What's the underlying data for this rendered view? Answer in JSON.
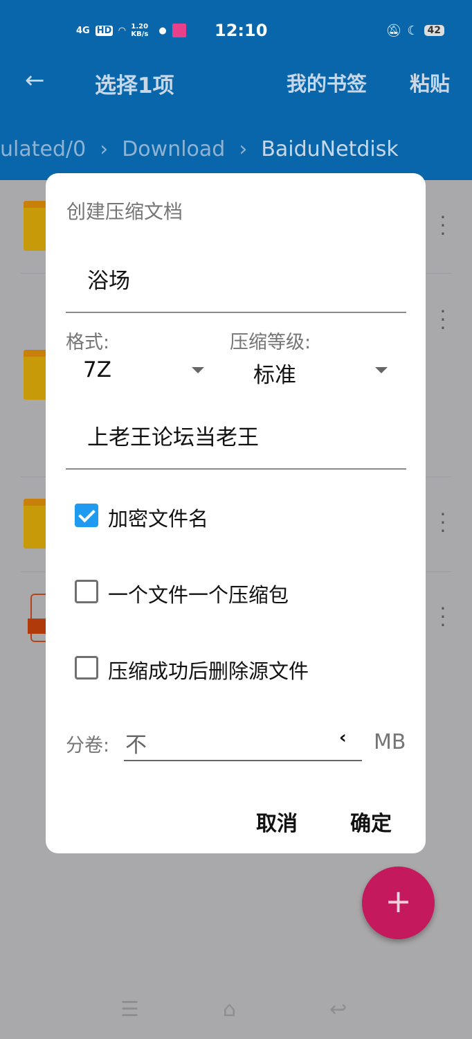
{
  "status": {
    "network": "4G",
    "hd": "HD",
    "speed": "1.20 KB/s",
    "time": "12:10",
    "battery": "42"
  },
  "appbar": {
    "title": "选择1项",
    "bookmarks": "我的书签",
    "paste": "粘贴"
  },
  "breadcrumbs": [
    "ulated/0",
    "Download",
    "BaiduNetdisk"
  ],
  "dialog": {
    "title": "创建压缩文档",
    "name_value": "浴场",
    "format_label": "格式:",
    "format_value": "7Z",
    "level_label": "压缩等级:",
    "level_value": "标准",
    "password_value": "上老王论坛当老王",
    "options": [
      {
        "label": "加密文件名",
        "checked": true
      },
      {
        "label": "一个文件一个压缩包",
        "checked": false
      },
      {
        "label": "压缩成功后删除源文件",
        "checked": false
      }
    ],
    "split_label": "分卷:",
    "split_value": "不",
    "split_unit": "MB",
    "cancel": "取消",
    "ok": "确定"
  },
  "fab": "+",
  "colors": {
    "appbar": "#0a66aa",
    "accent": "#1e9bf0",
    "fab": "#c4195c"
  }
}
